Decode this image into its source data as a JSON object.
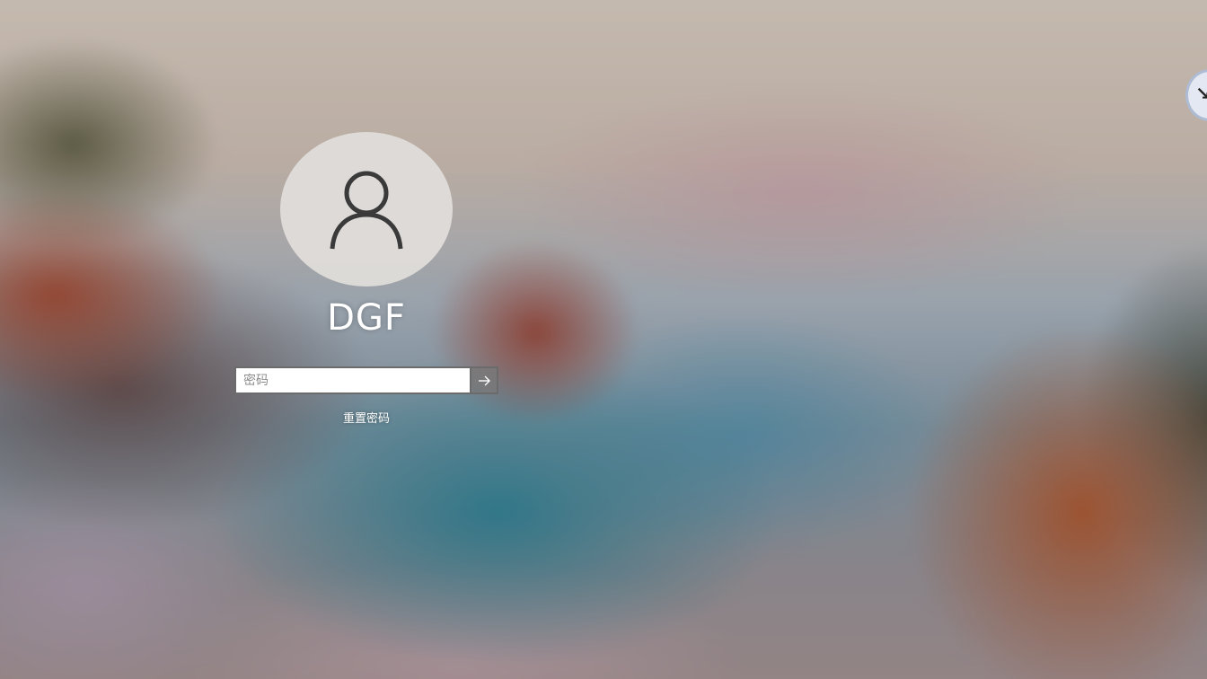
{
  "login": {
    "username": "DGF",
    "password_placeholder": "密码",
    "password_value": "",
    "reset_password_label": "重置密码"
  },
  "icons": {
    "avatar": "user-silhouette-icon",
    "submit": "arrow-right-icon"
  },
  "colors": {
    "avatar_fill": "#e1ded9",
    "input_border": "#6b6b6b",
    "text": "#ffffff"
  }
}
